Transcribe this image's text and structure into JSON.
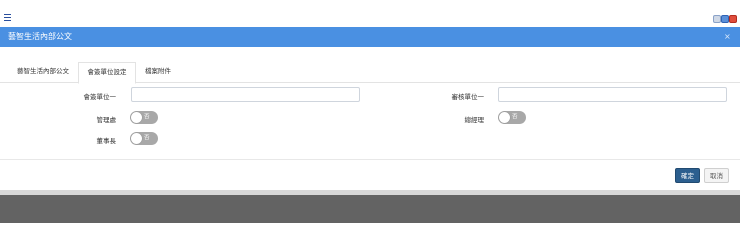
{
  "window": {
    "menu_icon": "menu-icon",
    "controls": [
      "restore-icon",
      "minimize-icon",
      "close-icon"
    ]
  },
  "dialog": {
    "title": "藝智生活內部公文",
    "close_glyph": "×",
    "tabs": [
      {
        "label": "藝智生活內部公文"
      },
      {
        "label": "會簽單位設定"
      },
      {
        "label": "檔案附件"
      }
    ],
    "form": {
      "countersign_unit_1": {
        "label": "會簽單位一",
        "value": ""
      },
      "review_unit_1": {
        "label": "審核單位一",
        "value": ""
      },
      "management_office": {
        "label": "管理處",
        "toggle_text": "否",
        "on": false
      },
      "general_manager": {
        "label": "總經理",
        "toggle_text": "否",
        "on": false
      },
      "chairman": {
        "label": "董事長",
        "toggle_text": "否",
        "on": false
      }
    },
    "buttons": {
      "ok": "確定",
      "cancel": "取消"
    }
  },
  "colors": {
    "header": "#4a90e2",
    "primary_button": "#2c5f8f",
    "toggle_off": "#a8a8a8",
    "backdrop": "#636363"
  }
}
